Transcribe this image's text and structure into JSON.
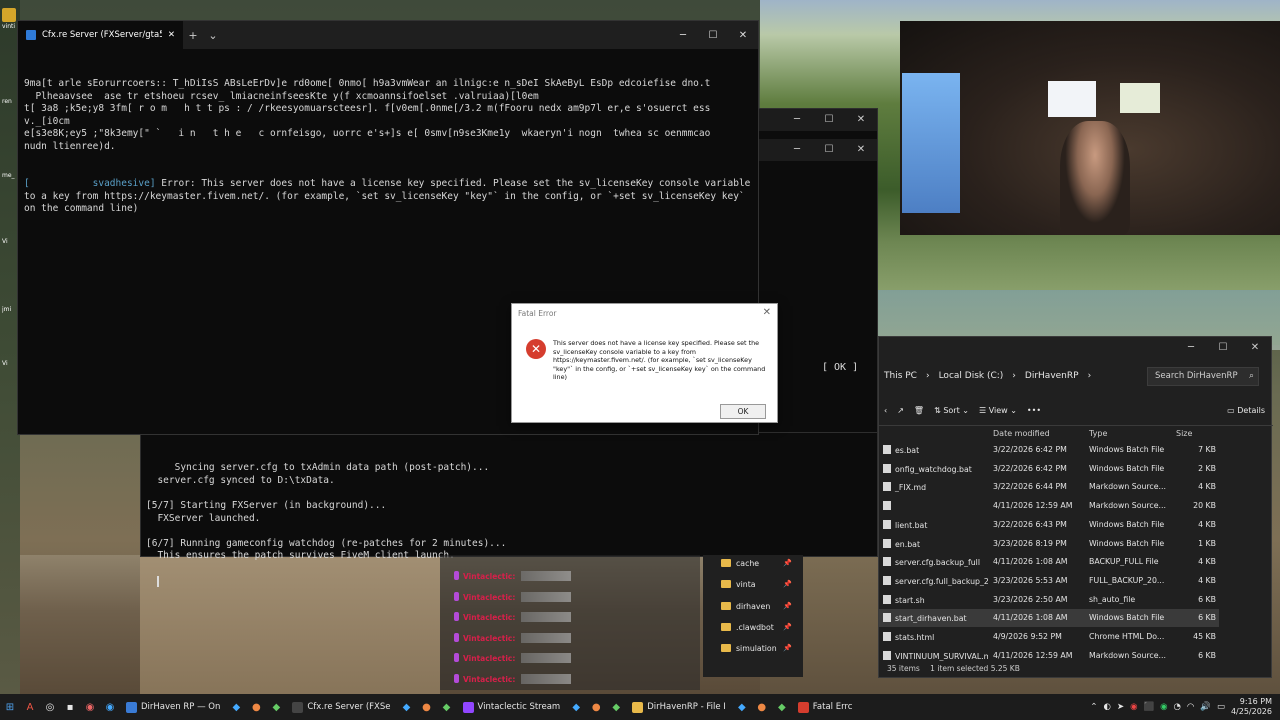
{
  "terminal": {
    "tab_title": "Cfx.re Server (FXServer/gta5)",
    "lines": [
      "9ma[t arle sEorurrcoers:: T_hDiIsS ABsLeErDv]e rd0ome[ 0nmo[ h9a3vmWear an ilnigc:e n_sDeI SkAeByL EsDp edcoiefise dno.t",
      "  Plheaavsee  ase tr etshoeu rcsev_ lmiacneinfseesKte y(f xcmoannsifoelset .valruiaa)[l0em",
      "t[ 3a8 ;k5e;y8 3fm[ r o m   h t t ps : / /rkeesyomuarscteesr]. f[v0em[.0nme[/3.2 m(fFooru nedx am9p7l er,e s'osuerct ess",
      "v._[i0cm",
      "e[s3e8K;ey5 ;\"8k3emy[\" `   i n   t h e   c ornfeisgo, uorrc e's+]s e[ 0smv[n9se3Kme1y  wkaeryn'i nogn  twhea sc oenmmcao",
      "nudn ltienree)d."
    ],
    "error_prefix": "[           svadhesive]",
    "error_text": " Error: This server does not have a license key specified. Please set the sv_licenseKey console variable to a key from https://keymaster.fivem.net/. (for example, `set sv_licenseKey \"key\"` in the config, or `+set sv_licenseKey key` on the command line)"
  },
  "console2": {
    "lines": [
      "     Syncing server.cfg to txAdmin data path (post-patch)...",
      "  server.cfg synced to D:\\txData.",
      "",
      "[5/7] Starting FXServer (in background)...",
      "  FXServer launched.",
      "",
      "[6/7] Running gameconfig watchdog (re-patches for 2 minutes)...",
      "  This ensures the patch survives FiveM client launch."
    ],
    "ok_label": "[ OK ]"
  },
  "dialog": {
    "title": "Fatal Error",
    "message": "This server does not have a license key specified. Please set the sv_licenseKey console variable to a key from https://keymaster.fivem.net/. (for example, `set sv_licenseKey \"key\"` in the config, or `+set sv_licenseKey key` on the command line)",
    "ok_label": "OK"
  },
  "explorer": {
    "breadcrumb": [
      "This PC",
      "Local Disk (C:)",
      "DirHavenRP"
    ],
    "search_placeholder": "Search DirHavenRP",
    "toolbar": {
      "sort": "Sort",
      "view": "View",
      "more": "•••",
      "details": "Details"
    },
    "columns": {
      "date": "Date modified",
      "type": "Type",
      "size": "Size"
    },
    "files": [
      {
        "name": "es.bat",
        "date": "3/22/2026 6:42 PM",
        "type": "Windows Batch File",
        "size": "7 KB"
      },
      {
        "name": "onfig_watchdog.bat",
        "date": "3/22/2026 6:42 PM",
        "type": "Windows Batch File",
        "size": "2 KB"
      },
      {
        "name": "_FIX.md",
        "date": "3/22/2026 6:44 PM",
        "type": "Markdown Source...",
        "size": "4 KB"
      },
      {
        "name": "",
        "date": "4/11/2026 12:59 AM",
        "type": "Markdown Source...",
        "size": "20 KB"
      },
      {
        "name": "lient.bat",
        "date": "3/22/2026 6:43 PM",
        "type": "Windows Batch File",
        "size": "4 KB"
      },
      {
        "name": "en.bat",
        "date": "3/23/2026 8:19 PM",
        "type": "Windows Batch File",
        "size": "1 KB"
      },
      {
        "name": "server.cfg.backup_full",
        "date": "4/11/2026 1:08 AM",
        "type": "BACKUP_FULL File",
        "size": "4 KB"
      },
      {
        "name": "server.cfg.full_backup_20260323_055334",
        "date": "3/23/2026 5:53 AM",
        "type": "FULL_BACKUP_20...",
        "size": "4 KB"
      },
      {
        "name": "start.sh",
        "date": "3/23/2026 2:50 AM",
        "type": "sh_auto_file",
        "size": "6 KB"
      },
      {
        "name": "start_dirhaven.bat",
        "date": "4/11/2026 1:08 AM",
        "type": "Windows Batch File",
        "size": "6 KB"
      },
      {
        "name": "stats.html",
        "date": "4/9/2026 9:52 PM",
        "type": "Chrome HTML Do...",
        "size": "45 KB"
      },
      {
        "name": "VINTINUUM_SURVIVAL.md",
        "date": "4/11/2026 12:59 AM",
        "type": "Markdown Source...",
        "size": "6 KB"
      }
    ],
    "status_items": "35 items",
    "status_selected": "1 item selected  5.25 KB"
  },
  "navpane": {
    "items": [
      "cache",
      "vinta",
      "dirhaven",
      ".clawdbot",
      "simulation"
    ]
  },
  "chat": {
    "username": "Vintaclectic:",
    "count": 7
  },
  "taskbar": {
    "apps": [
      {
        "label": "DirHaven RP — On",
        "color": "#3a7bd5"
      },
      {
        "label": "Cfx.re Server (FXSe",
        "color": "#444"
      },
      {
        "label": "Vintaclectic Stream",
        "color": "#9146ff"
      },
      {
        "label": "DirHavenRP - File I",
        "color": "#e8b94a"
      },
      {
        "label": "Fatal Errc",
        "color": "#d53d2e"
      }
    ],
    "time": "9:16 PM",
    "date": "4/25/2026"
  },
  "desktop_icons": [
    "vinti",
    "ren",
    "me_",
    "Vi",
    "jmi",
    "Vi"
  ]
}
